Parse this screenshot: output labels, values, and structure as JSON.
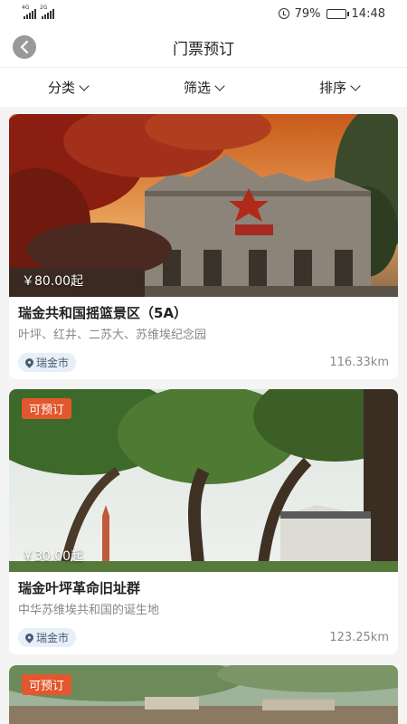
{
  "status_bar": {
    "left_signal_1": "4G",
    "left_signal_2": "2G",
    "battery": "79%",
    "time": "14:48"
  },
  "nav": {
    "title": "门票预订",
    "back_icon": "chevron-left-icon"
  },
  "filters": [
    {
      "label": "分类"
    },
    {
      "label": "筛选"
    },
    {
      "label": "排序"
    }
  ],
  "cards": [
    {
      "price": "￥80.00起",
      "badge": "",
      "title": "瑞金共和国摇篮景区（5A）",
      "desc": "叶坪、红井、二苏大、苏维埃纪念园",
      "location": "瑞金市",
      "distance": "116.33km"
    },
    {
      "price": "￥30.00起",
      "badge": "可预订",
      "title": "瑞金叶坪革命旧址群",
      "desc": "中华苏维埃共和国的诞生地",
      "location": "瑞金市",
      "distance": "123.25km"
    },
    {
      "badge": "可预订"
    }
  ],
  "colors": {
    "accent": "#e4572e",
    "location_tag_bg": "#e7eff8"
  }
}
